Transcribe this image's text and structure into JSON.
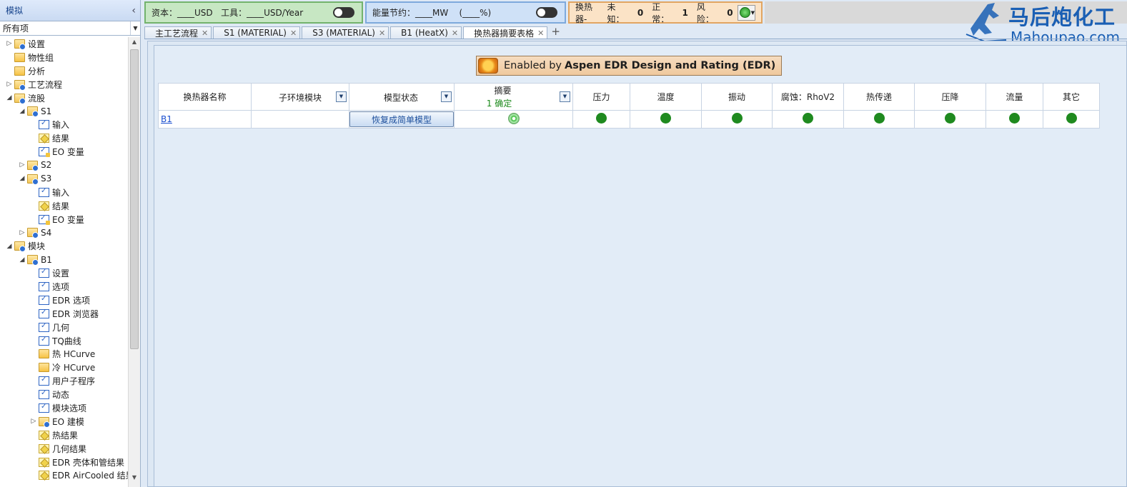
{
  "left_panel": {
    "title": "模拟",
    "collapse_glyph": "‹",
    "filter_value": "所有项",
    "tree": [
      {
        "label": "设置",
        "icon": "folderc",
        "level": 0,
        "arrow": "▷"
      },
      {
        "label": "物性组",
        "icon": "folder",
        "level": 0,
        "arrow": ""
      },
      {
        "label": "分析",
        "icon": "folder",
        "level": 0,
        "arrow": ""
      },
      {
        "label": "工艺流程",
        "icon": "folderc",
        "level": 0,
        "arrow": "▷"
      },
      {
        "label": "流股",
        "icon": "folderc",
        "level": 0,
        "arrow": "◢"
      },
      {
        "label": "S1",
        "icon": "folderc",
        "level": 1,
        "arrow": "◢"
      },
      {
        "label": "输入",
        "icon": "form",
        "level": 2,
        "arrow": ""
      },
      {
        "label": "结果",
        "icon": "result",
        "level": 2,
        "arrow": ""
      },
      {
        "label": "EO 变量",
        "icon": "eo",
        "level": 2,
        "arrow": ""
      },
      {
        "label": "S2",
        "icon": "folderc",
        "level": 1,
        "arrow": "▷"
      },
      {
        "label": "S3",
        "icon": "folderc",
        "level": 1,
        "arrow": "◢"
      },
      {
        "label": "输入",
        "icon": "form",
        "level": 2,
        "arrow": ""
      },
      {
        "label": "结果",
        "icon": "result",
        "level": 2,
        "arrow": ""
      },
      {
        "label": "EO 变量",
        "icon": "eo",
        "level": 2,
        "arrow": ""
      },
      {
        "label": "S4",
        "icon": "folderc",
        "level": 1,
        "arrow": "▷"
      },
      {
        "label": "模块",
        "icon": "folderc",
        "level": 0,
        "arrow": "◢"
      },
      {
        "label": "B1",
        "icon": "folderc",
        "level": 1,
        "arrow": "◢"
      },
      {
        "label": "设置",
        "icon": "form",
        "level": 2,
        "arrow": ""
      },
      {
        "label": "选项",
        "icon": "form",
        "level": 2,
        "arrow": ""
      },
      {
        "label": "EDR 选项",
        "icon": "form",
        "level": 2,
        "arrow": ""
      },
      {
        "label": "EDR 浏览器",
        "icon": "form",
        "level": 2,
        "arrow": ""
      },
      {
        "label": "几何",
        "icon": "form",
        "level": 2,
        "arrow": ""
      },
      {
        "label": "TQ曲线",
        "icon": "form",
        "level": 2,
        "arrow": ""
      },
      {
        "label": "热 HCurve",
        "icon": "folder",
        "level": 2,
        "arrow": ""
      },
      {
        "label": "冷 HCurve",
        "icon": "folder",
        "level": 2,
        "arrow": ""
      },
      {
        "label": "用户子程序",
        "icon": "form",
        "level": 2,
        "arrow": ""
      },
      {
        "label": "动态",
        "icon": "form",
        "level": 2,
        "arrow": ""
      },
      {
        "label": "模块选项",
        "icon": "form",
        "level": 2,
        "arrow": ""
      },
      {
        "label": "EO 建模",
        "icon": "folderc",
        "level": 2,
        "arrow": "▷"
      },
      {
        "label": "热结果",
        "icon": "result",
        "level": 2,
        "arrow": ""
      },
      {
        "label": "几何结果",
        "icon": "result",
        "level": 2,
        "arrow": ""
      },
      {
        "label": "EDR 壳体和管结果",
        "icon": "result",
        "level": 2,
        "arrow": ""
      },
      {
        "label": "EDR AirCooled 结果",
        "icon": "result",
        "level": 2,
        "arrow": ""
      }
    ]
  },
  "topbar": {
    "cost_text": "资本：____USD   工具：____USD/Year",
    "energy_text": "能量节约：____MW    (____%)",
    "hx_label": "换热器-",
    "hx_unknown_label": "未知：",
    "hx_unknown": "0",
    "hx_ok_label": "正常：",
    "hx_ok": "1",
    "hx_risk_label": "风险：",
    "hx_risk": "0"
  },
  "logo": {
    "cn": "马后炮化工",
    "en": "Mahoupao.com"
  },
  "tabs": [
    {
      "label": "主工艺流程",
      "active": false
    },
    {
      "label": "S1 (MATERIAL)",
      "active": false
    },
    {
      "label": "S3 (MATERIAL)",
      "active": false
    },
    {
      "label": "B1 (HeatX)",
      "active": false
    },
    {
      "label": "换热器摘要表格",
      "active": true
    }
  ],
  "banner": {
    "prefix": "Enabled by",
    "product": "Aspen EDR Design and Rating (EDR)"
  },
  "table": {
    "headers": {
      "name": "换热器名称",
      "subenv": "子环境模块",
      "model_status": "模型状态",
      "summary": "摘要",
      "summary_count": "1 确定",
      "pressure": "压力",
      "temperature": "温度",
      "vibration": "振动",
      "corrosion": "腐蚀：RhoV2",
      "heat_transfer": "热传递",
      "pressure_drop": "压降",
      "flow": "流量",
      "other": "其它"
    },
    "rows": [
      {
        "name": "B1",
        "subenv": "",
        "model_status_button": "恢复成简单模型"
      }
    ],
    "status_color": "#1f8a1f"
  },
  "colors": {
    "cost_bg": "#c7e7c3",
    "energy_bg": "#cfe1f7",
    "hx_bg": "#fbe3c6",
    "brand": "#1a5fb4"
  }
}
